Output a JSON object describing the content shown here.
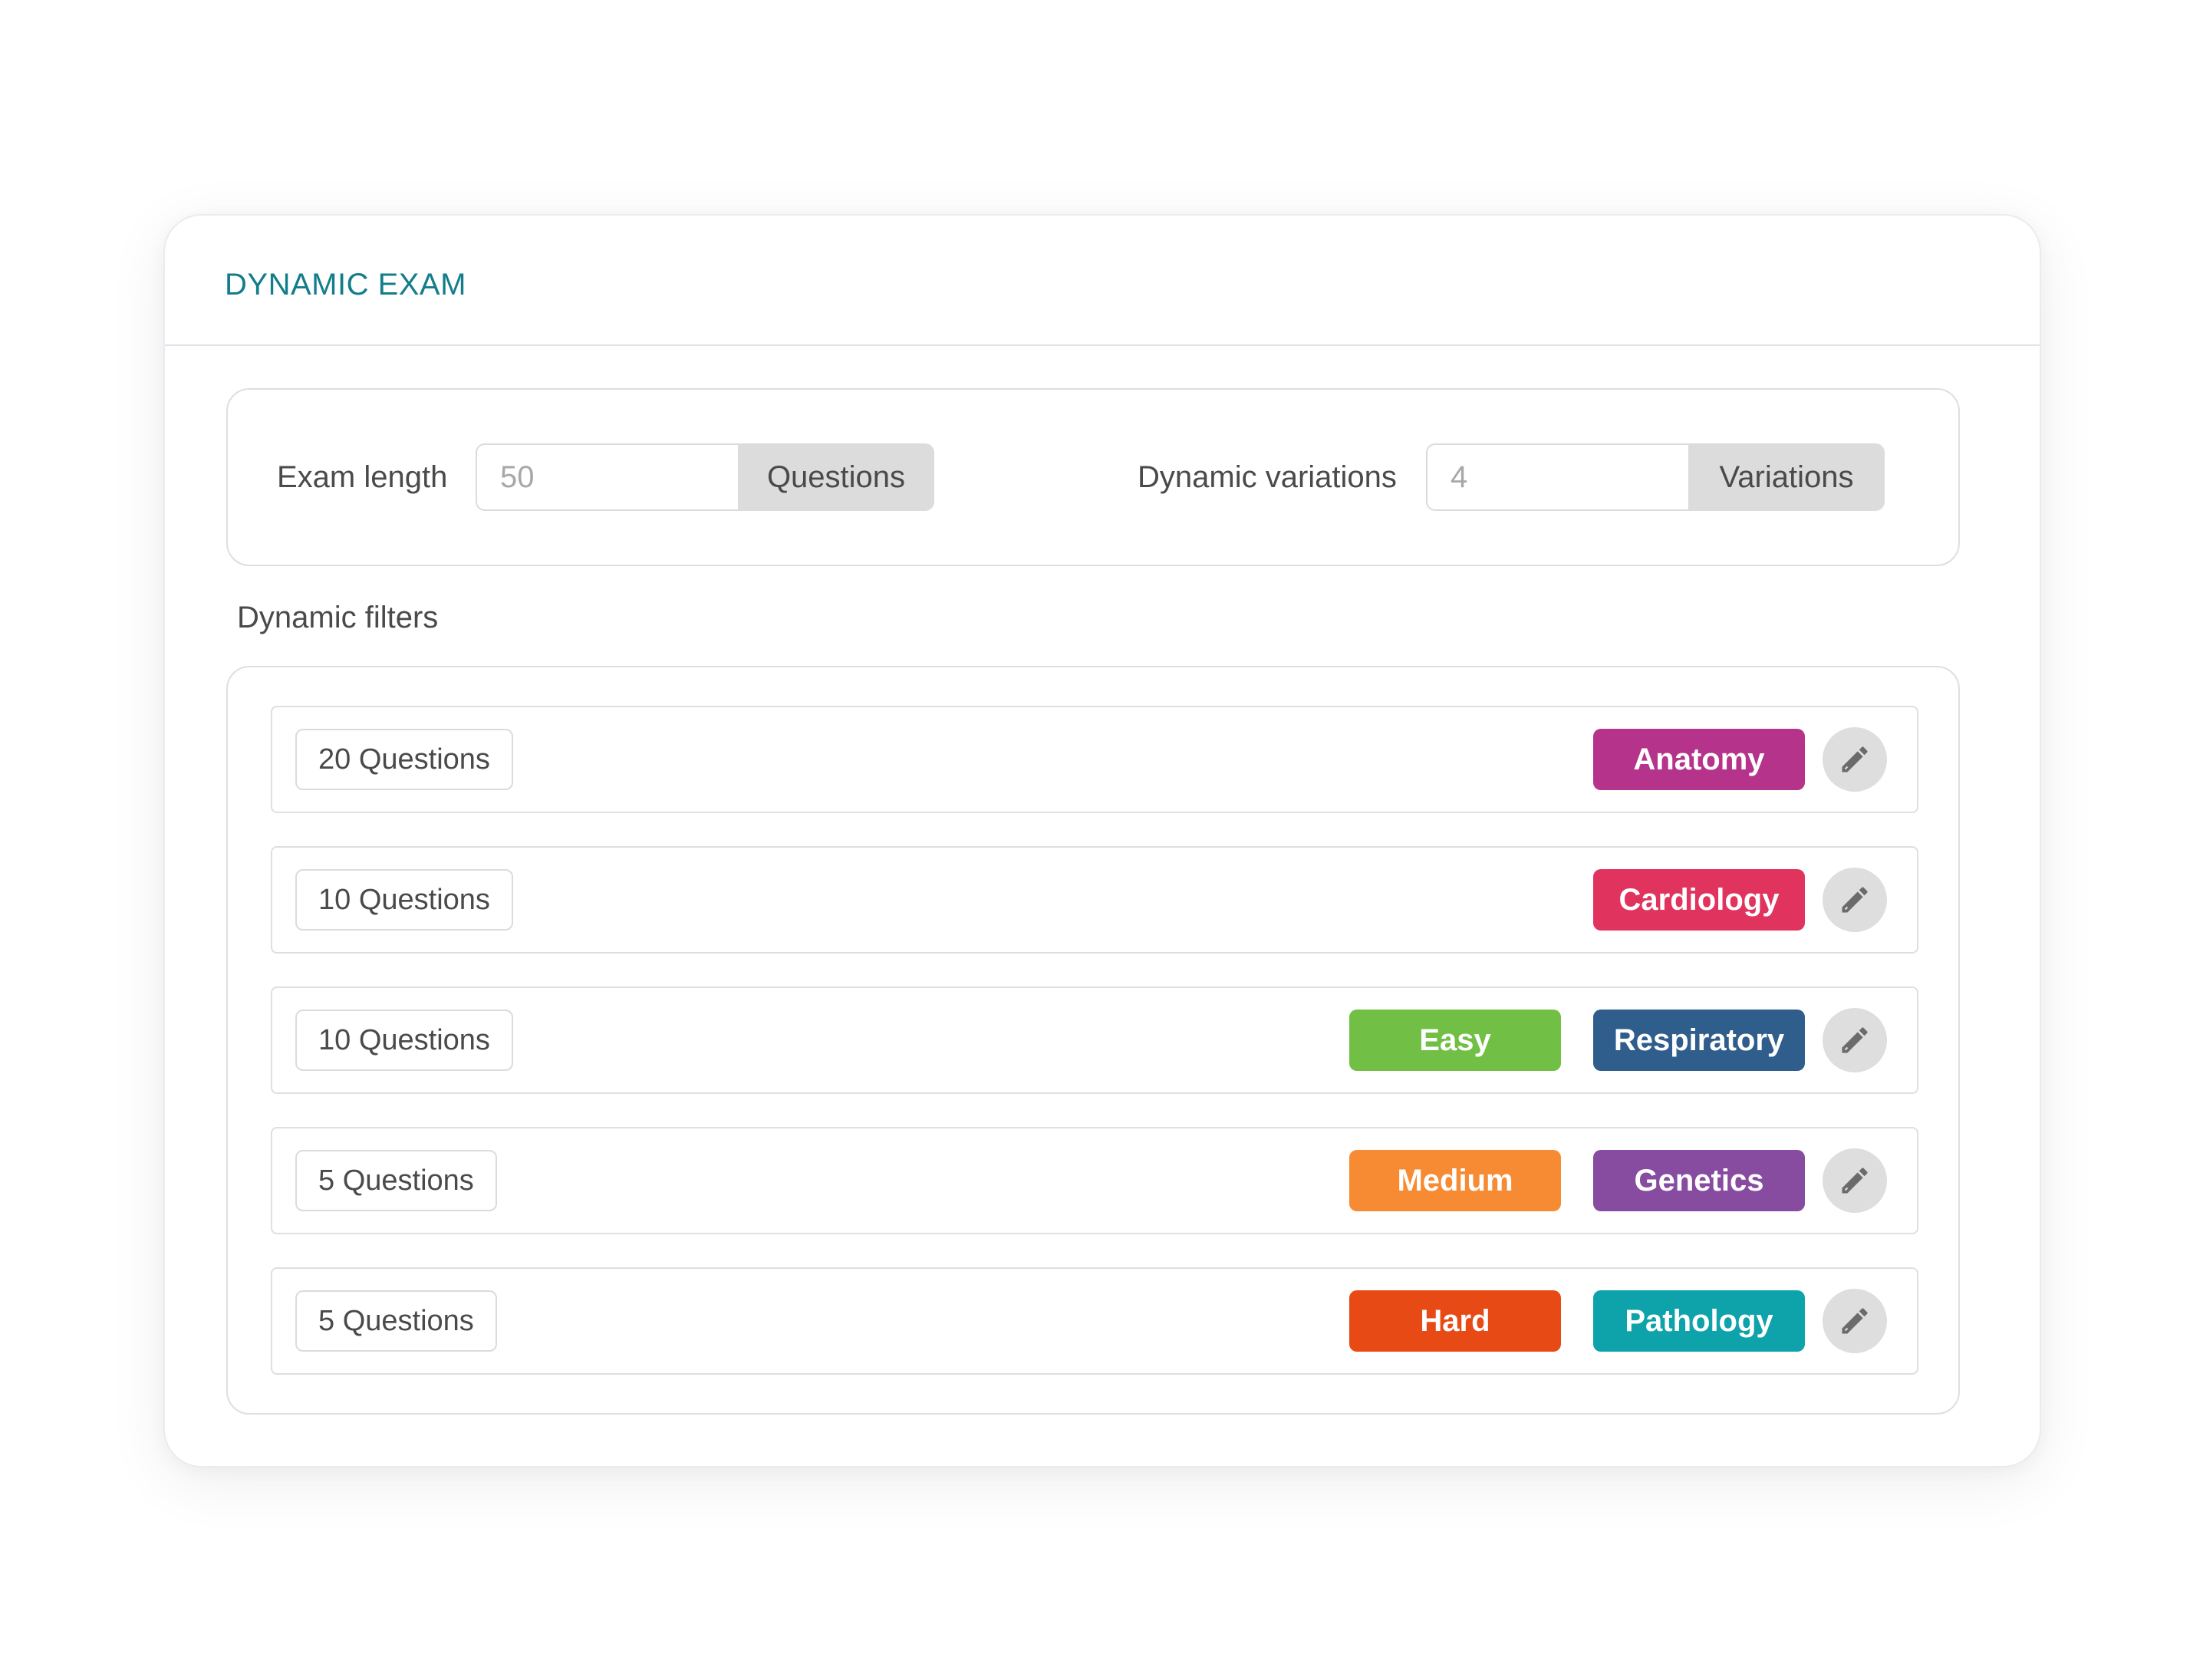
{
  "card": {
    "title": "DYNAMIC EXAM"
  },
  "settings": {
    "exam_length": {
      "label": "Exam length",
      "value": "50",
      "addon": "Questions"
    },
    "dynamic_variations": {
      "label": "Dynamic variations",
      "value": "4",
      "addon": "Variations"
    }
  },
  "filters": {
    "label": "Dynamic filters",
    "rows": [
      {
        "count": "20 Questions",
        "difficulty": null,
        "topic": {
          "label": "Anatomy",
          "color": "#b5338a"
        }
      },
      {
        "count": "10 Questions",
        "difficulty": null,
        "topic": {
          "label": "Cardiology",
          "color": "#e0335e"
        }
      },
      {
        "count": "10 Questions",
        "difficulty": {
          "label": "Easy",
          "color": "#71bf44"
        },
        "topic": {
          "label": "Respiratory",
          "color": "#2f5d8c"
        }
      },
      {
        "count": "5 Questions",
        "difficulty": {
          "label": "Medium",
          "color": "#f68b33"
        },
        "topic": {
          "label": "Genetics",
          "color": "#874b9f"
        }
      },
      {
        "count": "5 Questions",
        "difficulty": {
          "label": "Hard",
          "color": "#e84a15"
        },
        "topic": {
          "label": "Pathology",
          "color": "#0ea3ab"
        }
      }
    ],
    "edit_icon": "pencil-icon"
  }
}
